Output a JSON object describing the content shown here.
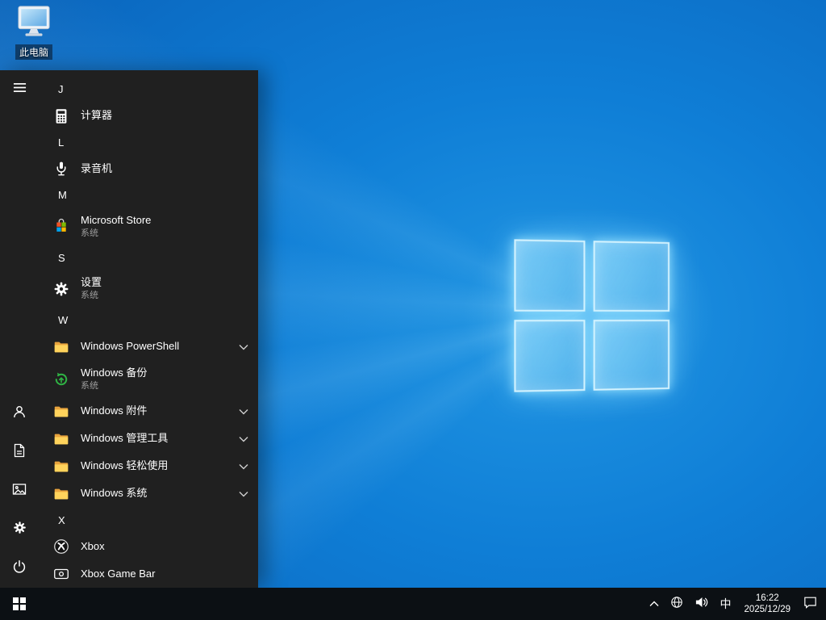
{
  "colors": {
    "desktop_blue_center": "#2196e3",
    "desktop_blue_edge": "#09509c",
    "logo_pane_blue": "#5fc0f0",
    "menu_bg": "#202020",
    "taskbar_bg": "#0c1014",
    "folder_yellow": "#ffd35c",
    "secondary_text": "#9d9d9d",
    "store_red": "#f25022",
    "store_green": "#7fba00",
    "store_blue": "#00a4ef",
    "store_yellow": "#ffb900",
    "backup_green": "#2fb344"
  },
  "desktop": {
    "this_pc_label": "此电脑"
  },
  "start_menu": {
    "rail": {
      "items": [
        "menu",
        "user",
        "documents",
        "pictures",
        "settings",
        "power"
      ]
    },
    "sections": [
      {
        "letter": "J",
        "items": [
          {
            "label": "计算器",
            "icon": "calculator-icon"
          }
        ]
      },
      {
        "letter": "L",
        "items": [
          {
            "label": "录音机",
            "icon": "microphone-icon"
          }
        ]
      },
      {
        "letter": "M",
        "items": [
          {
            "label": "Microsoft Store",
            "sub": "系统",
            "icon": "store-icon"
          }
        ]
      },
      {
        "letter": "S",
        "items": [
          {
            "label": "设置",
            "sub": "系统",
            "icon": "gear-icon"
          }
        ]
      },
      {
        "letter": "W",
        "items": [
          {
            "label": "Windows PowerShell",
            "icon": "folder-icon",
            "expandable": true
          },
          {
            "label": "Windows 备份",
            "sub": "系统",
            "icon": "backup-icon"
          },
          {
            "label": "Windows 附件",
            "icon": "folder-icon",
            "expandable": true
          },
          {
            "label": "Windows 管理工具",
            "icon": "folder-icon",
            "expandable": true
          },
          {
            "label": "Windows 轻松使用",
            "icon": "folder-icon",
            "expandable": true
          },
          {
            "label": "Windows 系统",
            "icon": "folder-icon",
            "expandable": true
          }
        ]
      },
      {
        "letter": "X",
        "items": [
          {
            "label": "Xbox",
            "icon": "xbox-icon"
          },
          {
            "label": "Xbox Game Bar",
            "icon": "gamebar-icon"
          }
        ]
      }
    ]
  },
  "taskbar": {
    "time": "16:22",
    "date": "2025/12/29",
    "ime": "中"
  }
}
